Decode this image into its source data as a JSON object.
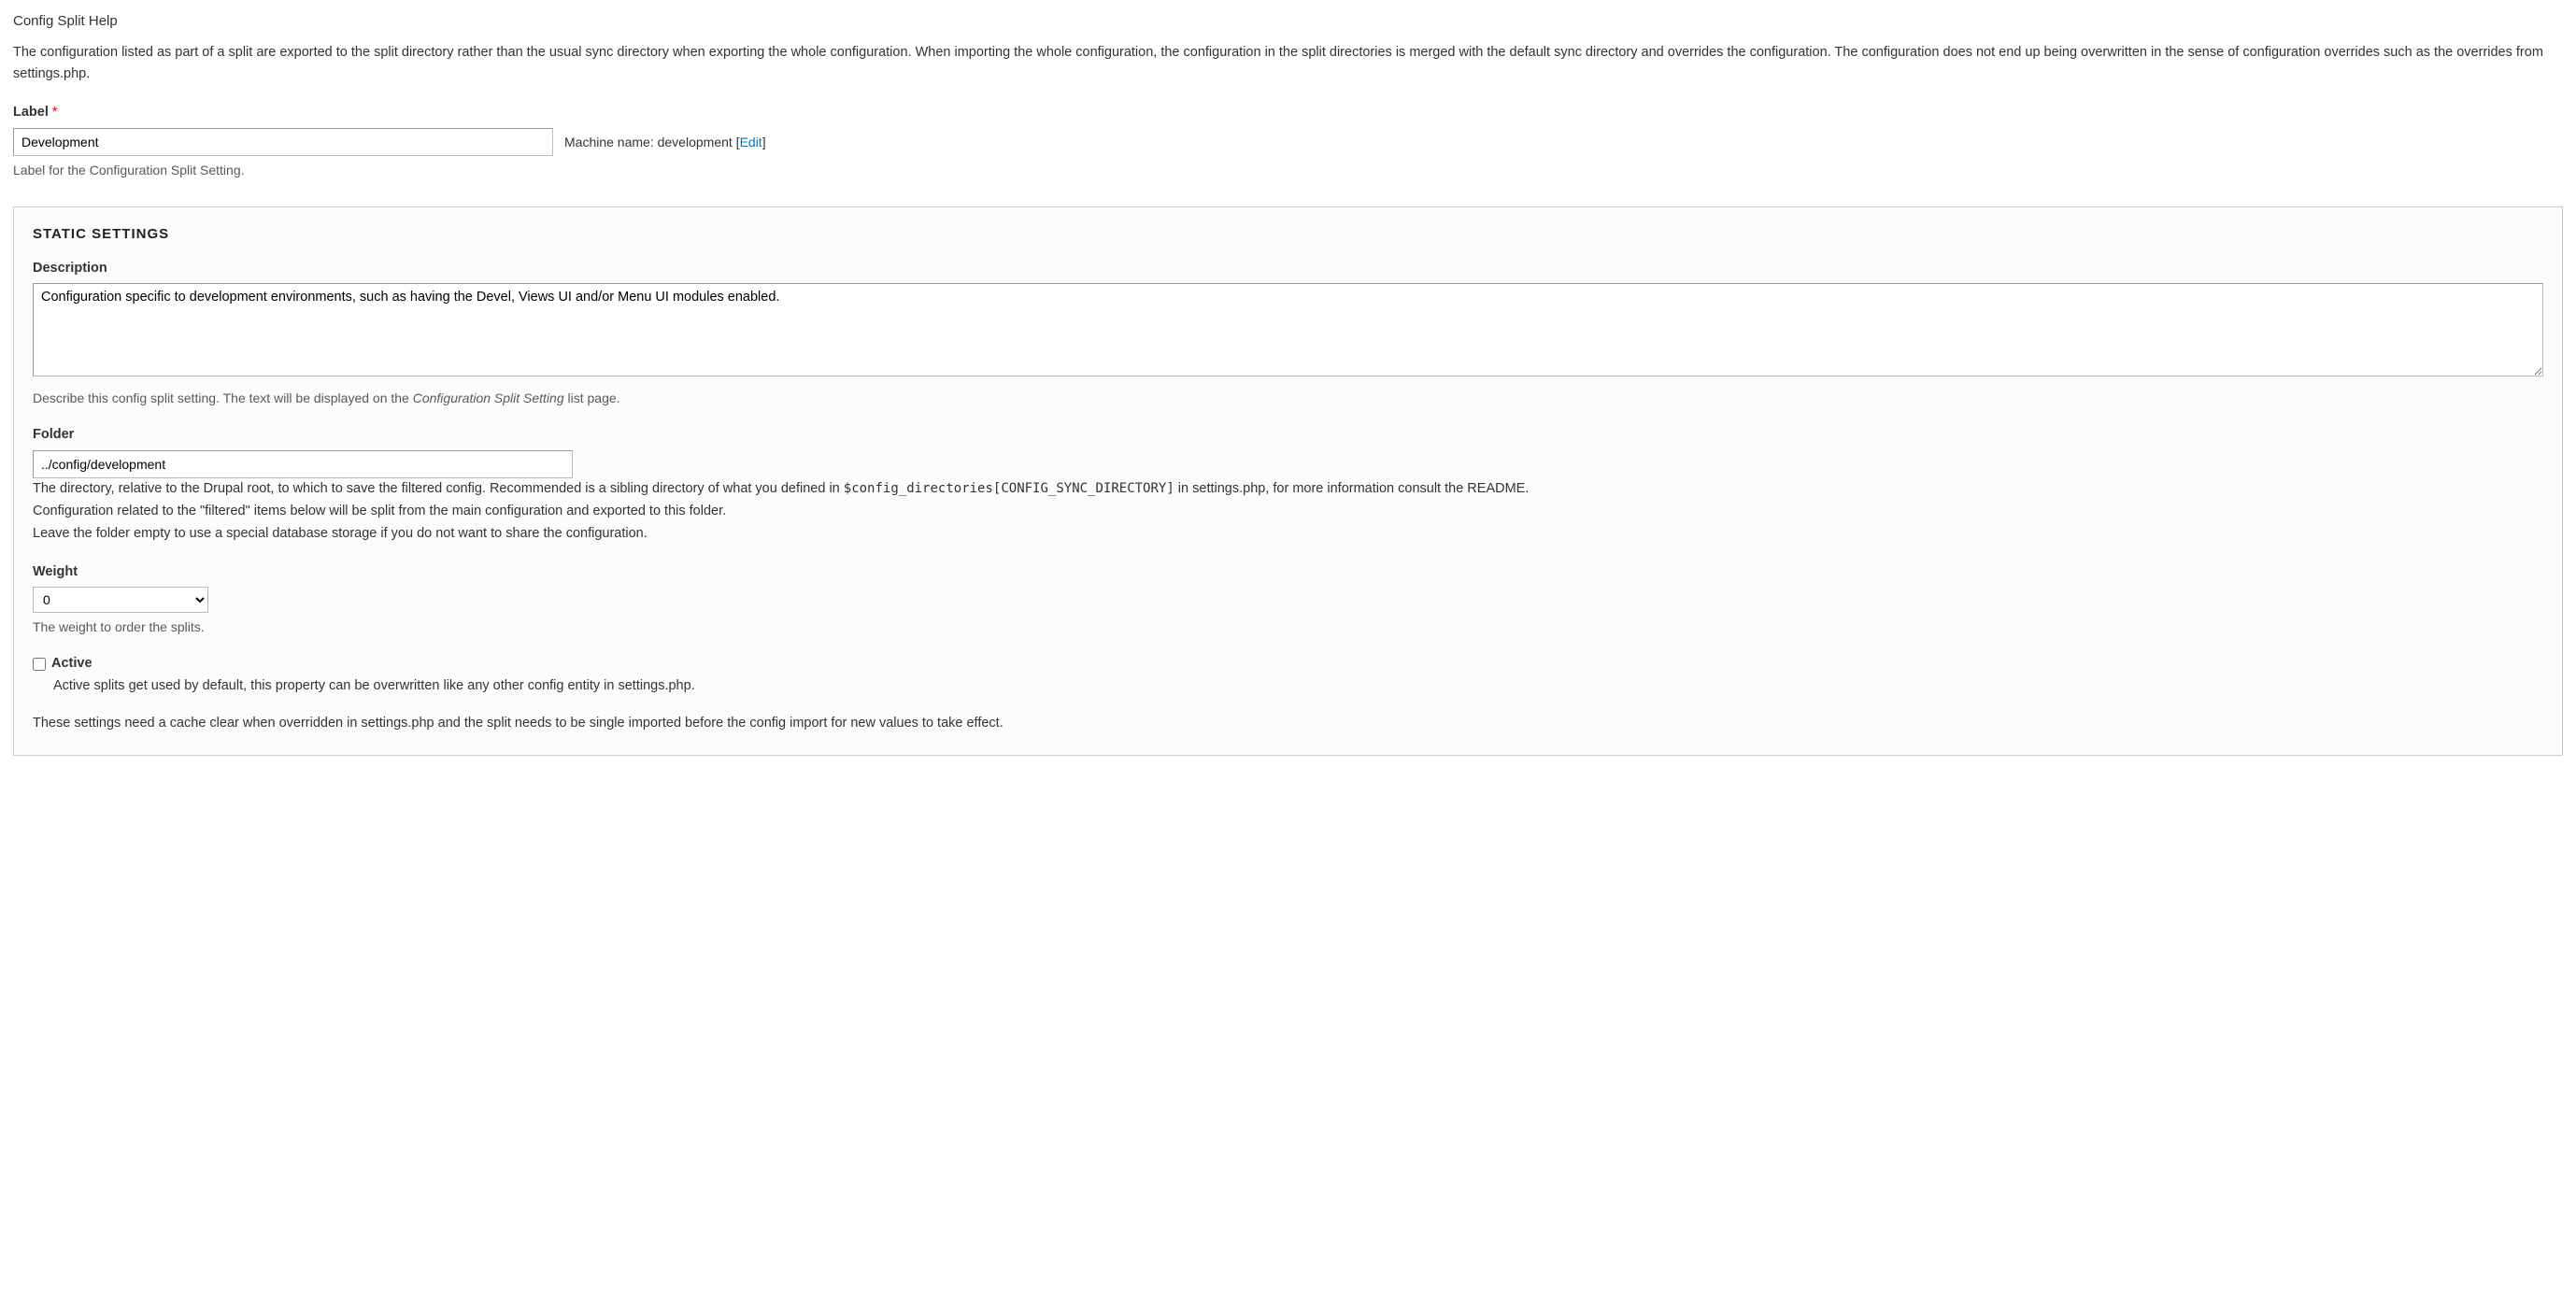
{
  "help": {
    "title": "Config Split Help",
    "text": "The configuration listed as part of a split are exported to the split directory rather than the usual sync directory when exporting the whole configuration. When importing the whole configuration, the configuration in the split directories is merged with the default sync directory and overrides the configuration. The configuration does not end up being overwritten in the sense of configuration overrides such as the overrides from settings.php."
  },
  "label": {
    "label": "Label",
    "value": "Development",
    "machine_prefix": "Machine name: ",
    "machine_value": "development",
    "edit_link": "Edit",
    "help": "Label for the Configuration Split Setting."
  },
  "static": {
    "legend": "STATIC SETTINGS",
    "description": {
      "label": "Description",
      "value": "Configuration specific to development environments, such as having the Devel, Views UI and/or Menu UI modules enabled.",
      "help_pre": "Describe this config split setting. The text will be displayed on the ",
      "help_italic": "Configuration Split Setting",
      "help_post": " list page."
    },
    "folder": {
      "label": "Folder",
      "value": "../config/development",
      "help_line1_pre": "The directory, relative to the Drupal root, to which to save the filtered config. Recommended is a sibling directory of what you defined in ",
      "help_line1_code": "$config_directories[CONFIG_SYNC_DIRECTORY]",
      "help_line1_post": " in settings.php, for more information consult the README.",
      "help_line2": "Configuration related to the \"filtered\" items below will be split from the main configuration and exported to this folder.",
      "help_line3": "Leave the folder empty to use a special database storage if you do not want to share the configuration."
    },
    "weight": {
      "label": "Weight",
      "value": "0",
      "help": "The weight to order the splits."
    },
    "active": {
      "label": "Active",
      "checked": false,
      "help": "Active splits get used by default, this property can be overwritten like any other config entity in settings.php."
    },
    "cache_note": "These settings need a cache clear when overridden in settings.php and the split needs to be single imported before the config import for new values to take effect."
  }
}
